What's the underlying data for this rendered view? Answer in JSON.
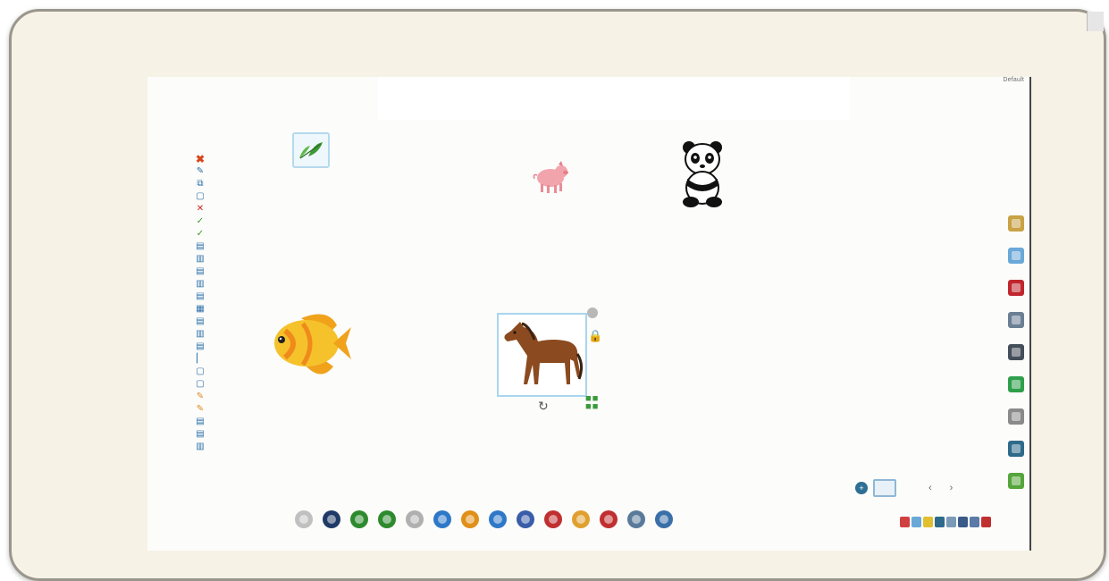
{
  "canvas": {
    "corner_label": "Default"
  },
  "left_toolbar": {
    "items": [
      {
        "glyph": "✖",
        "kind": "close"
      },
      {
        "glyph": "✎",
        "kind": "blue"
      },
      {
        "glyph": "⧉",
        "kind": "blue"
      },
      {
        "glyph": "▢",
        "kind": "blue"
      },
      {
        "glyph": "✕",
        "kind": "red"
      },
      {
        "glyph": "✓",
        "kind": "green"
      },
      {
        "glyph": "✓",
        "kind": "green"
      },
      {
        "glyph": "▤",
        "kind": "blue"
      },
      {
        "glyph": "▥",
        "kind": "blue"
      },
      {
        "glyph": "▤",
        "kind": "blue"
      },
      {
        "glyph": "▥",
        "kind": "blue"
      },
      {
        "glyph": "▤",
        "kind": "blue"
      },
      {
        "glyph": "▦",
        "kind": "blue"
      },
      {
        "glyph": "▤",
        "kind": "blue"
      },
      {
        "glyph": "▥",
        "kind": "blue"
      },
      {
        "glyph": "▤",
        "kind": "blue"
      },
      {
        "glyph": "▏",
        "kind": "blue"
      },
      {
        "glyph": "▢",
        "kind": "blue"
      },
      {
        "glyph": "▢",
        "kind": "blue"
      },
      {
        "glyph": "✎",
        "kind": "orange"
      },
      {
        "glyph": "✎",
        "kind": "orange"
      },
      {
        "glyph": "▤",
        "kind": "blue"
      },
      {
        "glyph": "▤",
        "kind": "blue"
      },
      {
        "glyph": "▥",
        "kind": "blue"
      }
    ]
  },
  "stickers": [
    {
      "name": "leaf-sticker",
      "icon": "leaf-icon"
    },
    {
      "name": "pig-sticker",
      "icon": "pig-icon"
    },
    {
      "name": "panda-sticker",
      "icon": "panda-icon"
    },
    {
      "name": "fish-sticker",
      "icon": "fish-icon"
    },
    {
      "name": "horse-sticker",
      "icon": "horse-icon",
      "selected": true
    }
  ],
  "right_toolbar": {
    "items": [
      {
        "name": "gallery-icon",
        "color": "#c9a246"
      },
      {
        "name": "document-icon",
        "color": "#6aa8d8"
      },
      {
        "name": "flash-icon",
        "color": "#c0262d"
      },
      {
        "name": "audio-icon",
        "color": "#6a7f94"
      },
      {
        "name": "video-icon",
        "color": "#444d5a"
      },
      {
        "name": "globe-icon",
        "color": "#2f9f4b"
      },
      {
        "name": "webcam-icon",
        "color": "#8a8a8a"
      },
      {
        "name": "tools-icon",
        "color": "#2e6a8a"
      },
      {
        "name": "trash-icon",
        "color": "#55a53b"
      }
    ]
  },
  "bottom_toolbar": {
    "items": [
      {
        "name": "spotlight-icon",
        "color": "#c0c0c0"
      },
      {
        "name": "screen-shade-icon",
        "color": "#1f3a66"
      },
      {
        "name": "undo-icon",
        "color": "#2e8a2e"
      },
      {
        "name": "redo-icon",
        "color": "#2e8a2e"
      },
      {
        "name": "clear-icon",
        "color": "#b0b0b0"
      },
      {
        "name": "previous-page-icon",
        "color": "#2f78c8"
      },
      {
        "name": "new-page-icon",
        "color": "#e09018"
      },
      {
        "name": "next-page-icon",
        "color": "#2f78c8"
      },
      {
        "name": "capture-icon",
        "color": "#3a5da8"
      },
      {
        "name": "eraser-icon",
        "color": "#c03030"
      },
      {
        "name": "highlighter-icon",
        "color": "#e0a030"
      },
      {
        "name": "marker-icon",
        "color": "#c03030"
      },
      {
        "name": "pen-icon",
        "color": "#5a7a9a"
      },
      {
        "name": "select-icon",
        "color": "#3a6fa8"
      }
    ]
  },
  "page_nav": {
    "prev": "‹",
    "next": "›"
  },
  "colors": {
    "accent": "#2d6f95",
    "selection_border": "#a9d5ef",
    "frame": "#f6f2e6"
  }
}
